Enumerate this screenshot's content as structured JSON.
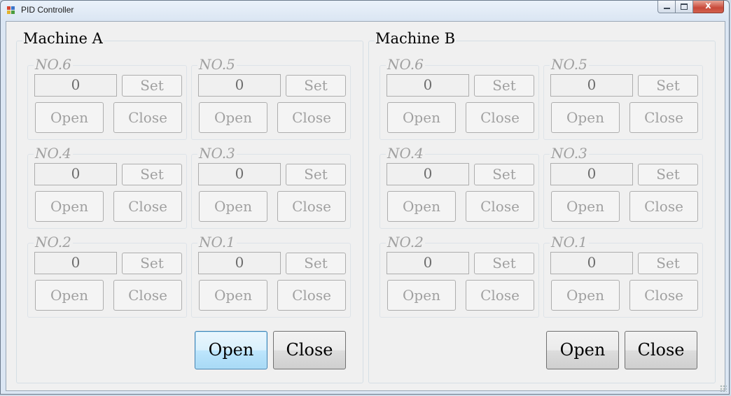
{
  "window": {
    "title": "PID Controller",
    "close_glyph": "x"
  },
  "machines": [
    {
      "label": "Machine A",
      "open_label": "Open",
      "close_label": "Close",
      "units": [
        {
          "name": "NO.6",
          "value": "0",
          "set": "Set",
          "open": "Open",
          "close": "Close"
        },
        {
          "name": "NO.5",
          "value": "0",
          "set": "Set",
          "open": "Open",
          "close": "Close"
        },
        {
          "name": "NO.4",
          "value": "0",
          "set": "Set",
          "open": "Open",
          "close": "Close"
        },
        {
          "name": "NO.3",
          "value": "0",
          "set": "Set",
          "open": "Open",
          "close": "Close"
        },
        {
          "name": "NO.2",
          "value": "0",
          "set": "Set",
          "open": "Open",
          "close": "Close"
        },
        {
          "name": "NO.1",
          "value": "0",
          "set": "Set",
          "open": "Open",
          "close": "Close"
        }
      ]
    },
    {
      "label": "Machine B",
      "open_label": "Open",
      "close_label": "Close",
      "units": [
        {
          "name": "NO.6",
          "value": "0",
          "set": "Set",
          "open": "Open",
          "close": "Close"
        },
        {
          "name": "NO.5",
          "value": "0",
          "set": "Set",
          "open": "Open",
          "close": "Close"
        },
        {
          "name": "NO.4",
          "value": "0",
          "set": "Set",
          "open": "Open",
          "close": "Close"
        },
        {
          "name": "NO.3",
          "value": "0",
          "set": "Set",
          "open": "Open",
          "close": "Close"
        },
        {
          "name": "NO.2",
          "value": "0",
          "set": "Set",
          "open": "Open",
          "close": "Close"
        },
        {
          "name": "NO.1",
          "value": "0",
          "set": "Set",
          "open": "Open",
          "close": "Close"
        }
      ]
    }
  ]
}
